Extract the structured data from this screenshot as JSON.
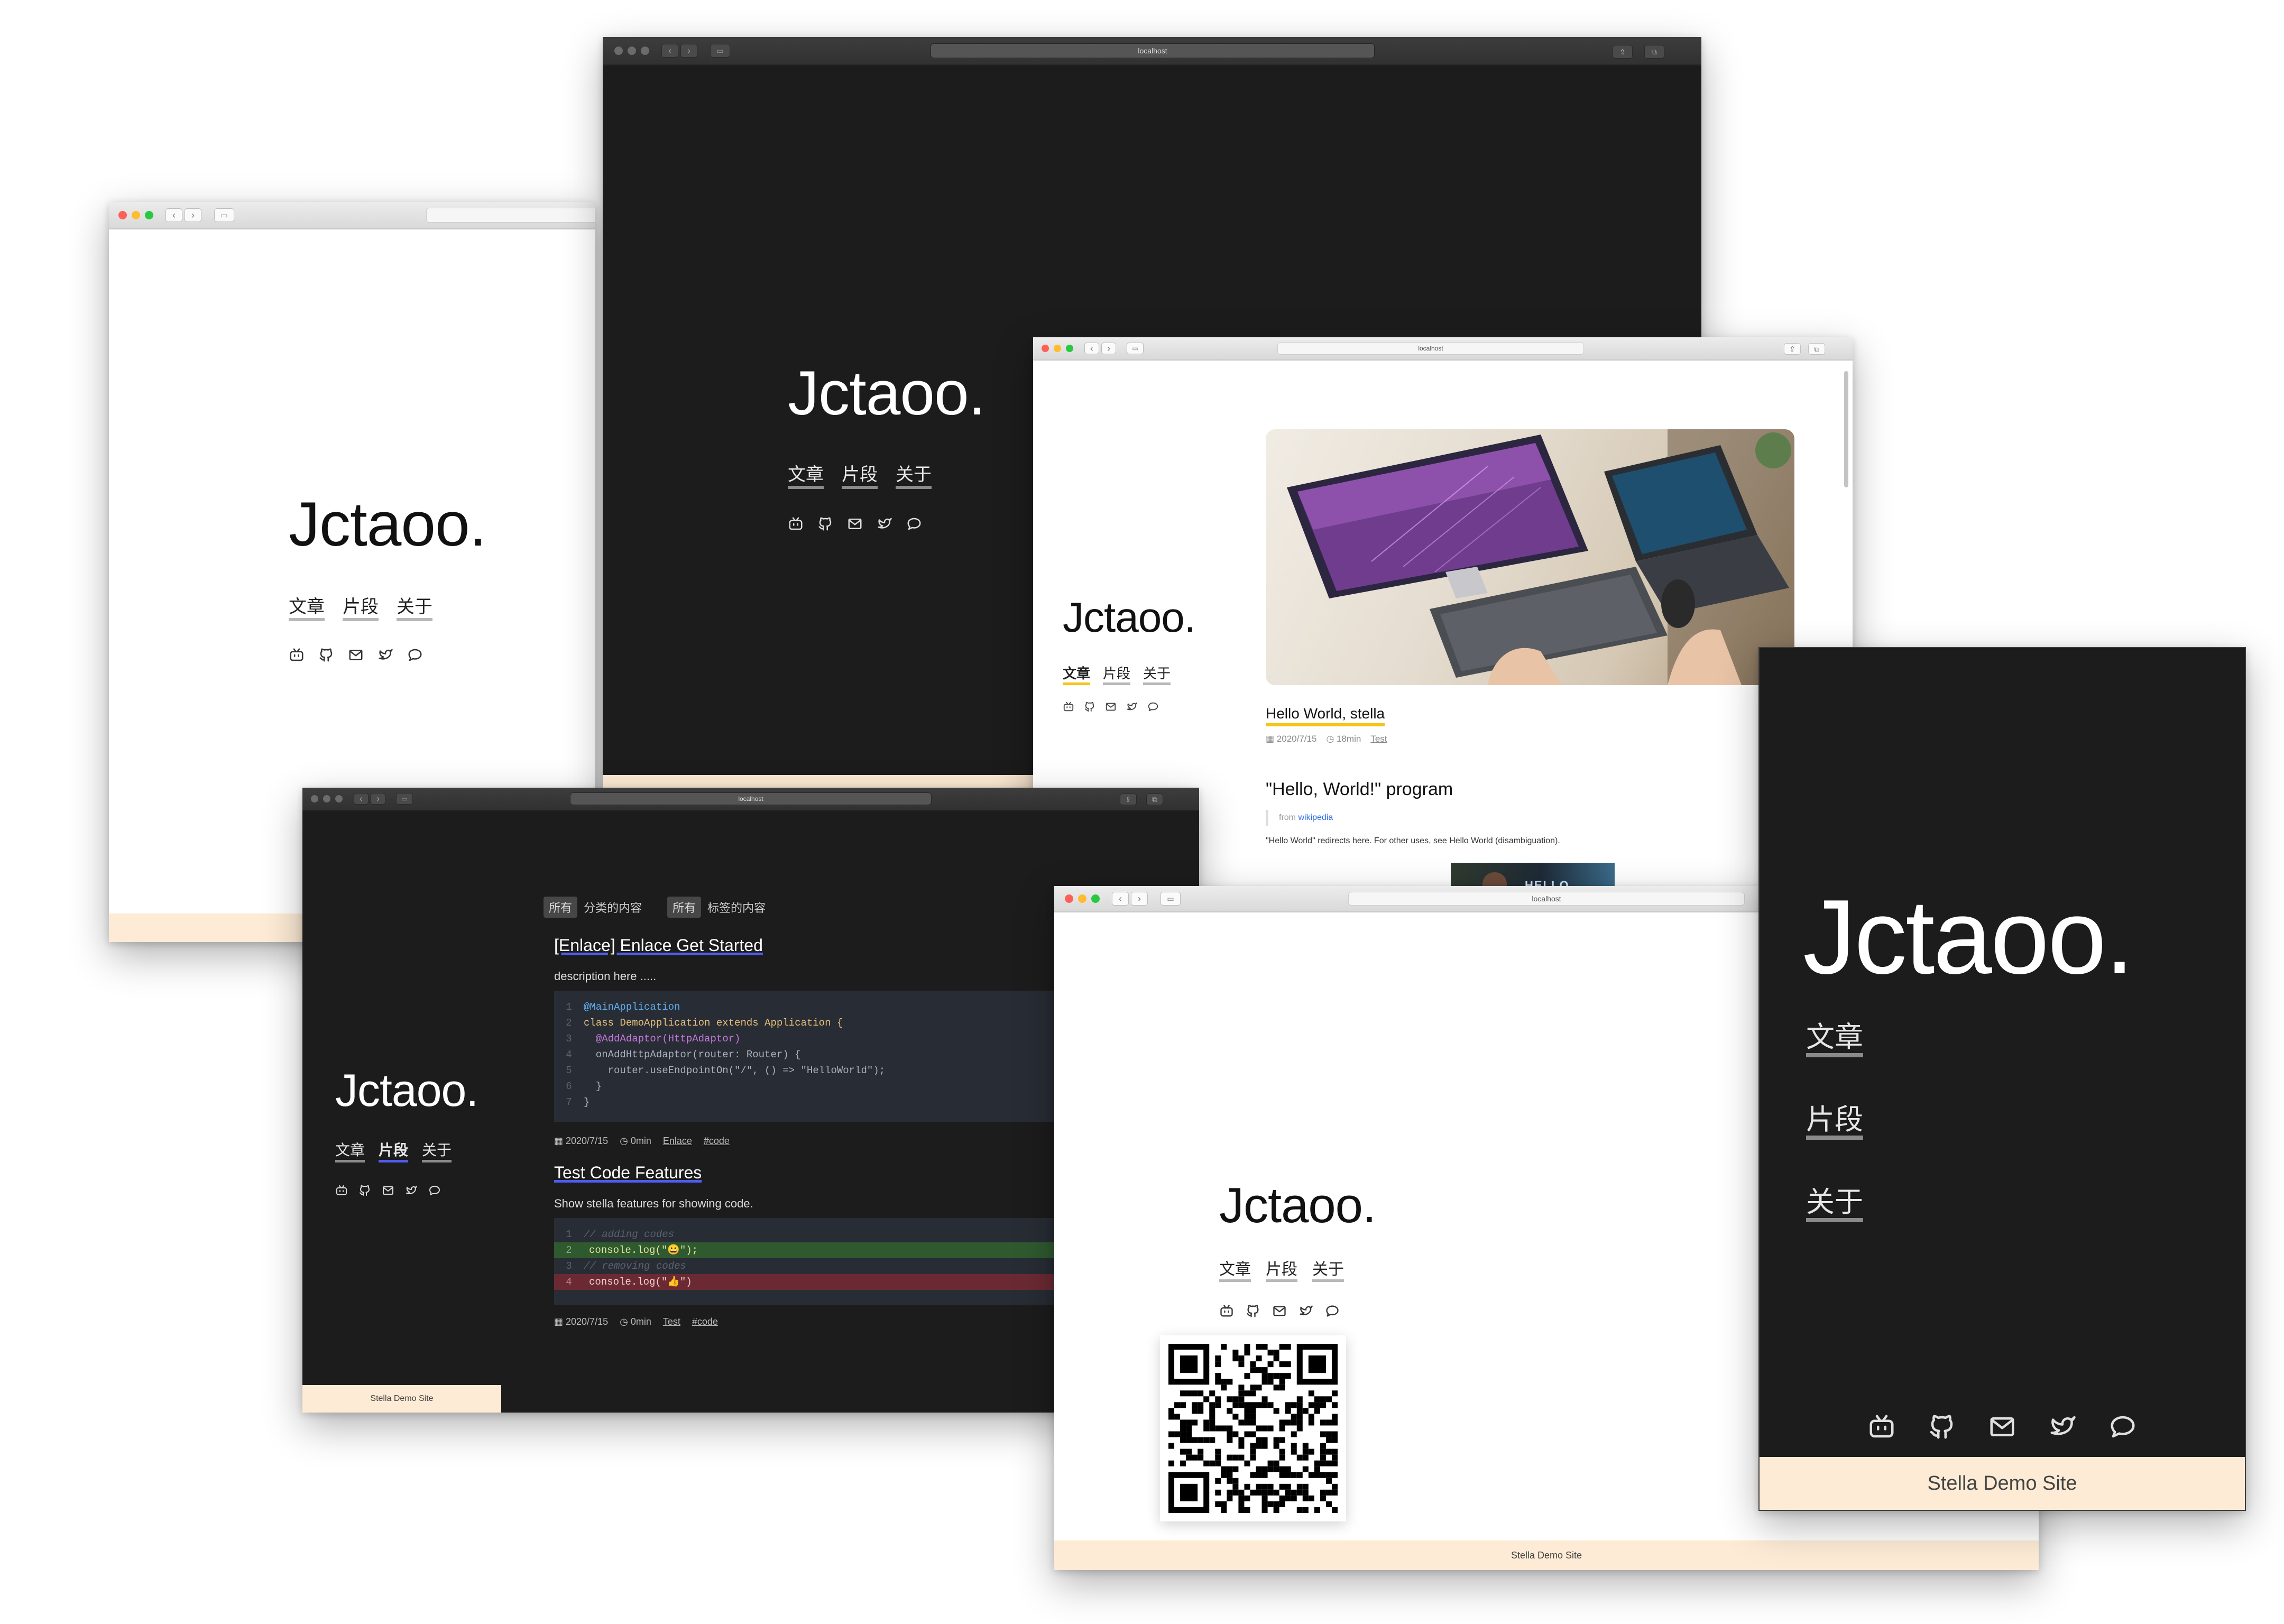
{
  "site": {
    "logo": "Jctaoo.",
    "nav": [
      "文章",
      "片段",
      "关于"
    ],
    "footer": "Stella Demo Site",
    "url": "localhost",
    "social_icons": [
      "bilibili-icon",
      "github-icon",
      "mail-icon",
      "twitter-icon",
      "chat-icon"
    ]
  },
  "blog": {
    "post": {
      "title": "Hello World, stella",
      "date": "2020/7/15",
      "read": "18min",
      "tag": "Test"
    },
    "article": {
      "heading": "\"Hello, World!\" program",
      "quote_prefix": "from",
      "quote_link": "wikipedia",
      "body": "\"Hello World\" redirects here. For other uses, see Hello World (disambiguation).",
      "thumb_text": "HELLO"
    }
  },
  "snippets": {
    "filter_category_chip": "所有",
    "filter_category_label": "分类的内容",
    "filter_tag_chip": "所有",
    "filter_tag_label": "标签的内容",
    "items": [
      {
        "title": "[Enlace] Enlace Get Started",
        "desc": "description here .....",
        "date": "2020/7/15",
        "read": "0min",
        "category": "Enlace",
        "tag": "#code"
      },
      {
        "title": "Test Code Features",
        "desc": "Show stella features for showing code.",
        "date": "2020/7/15",
        "read": "0min",
        "category": "Test",
        "tag": "#code"
      }
    ],
    "code1": [
      {
        "n": "1",
        "t": "@MainApplication"
      },
      {
        "n": "2",
        "t": "class DemoApplication extends Application {"
      },
      {
        "n": "3",
        "t": "  @AddAdaptor(HttpAdaptor)"
      },
      {
        "n": "4",
        "t": "  onAddHttpAdaptor(router: Router) {"
      },
      {
        "n": "5",
        "t": "    router.useEndpointOn(\"/\", () => \"HelloWorld\");"
      },
      {
        "n": "6",
        "t": "  }"
      },
      {
        "n": "7",
        "t": "}"
      }
    ],
    "code2": [
      {
        "n": "1",
        "t": "// adding codes"
      },
      {
        "n": "2",
        "t": "console.log(\"😀\");"
      },
      {
        "n": "3",
        "t": "// removing codes"
      },
      {
        "n": "4",
        "t": "console.log(\"👍\")"
      }
    ]
  },
  "colors": {
    "dark_bg": "#1c1c1c",
    "footer_bg": "#fdebd5",
    "accent_yellow": "#f5c518",
    "accent_blue": "#4f5cf0",
    "code_bg": "#282c34"
  }
}
